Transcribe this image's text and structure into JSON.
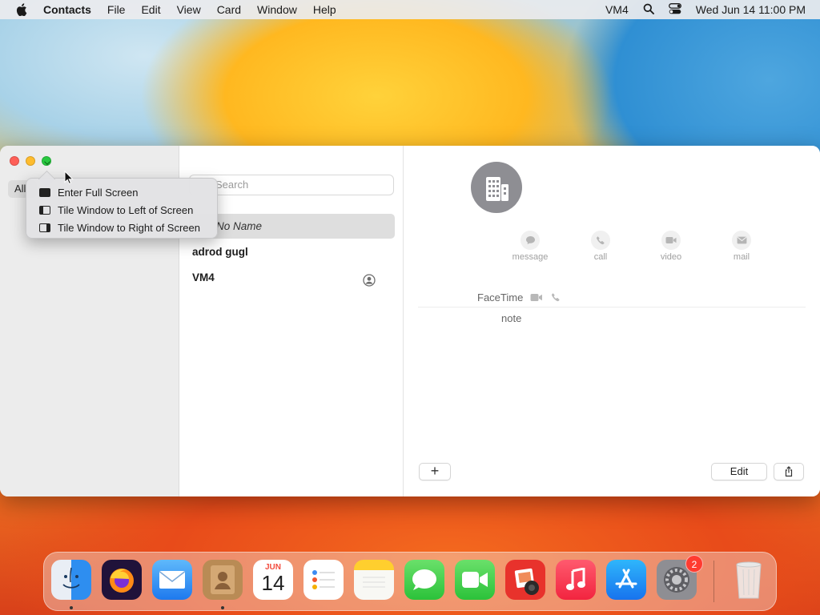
{
  "menubar": {
    "app_name": "Contacts",
    "items": [
      "File",
      "Edit",
      "View",
      "Card",
      "Window",
      "Help"
    ],
    "user": "VM4",
    "datetime": "Wed Jun 14  11:00 PM"
  },
  "sidebar": {
    "all_label": "All"
  },
  "popup": {
    "items": [
      "Enter Full Screen",
      "Tile Window to Left of Screen",
      "Tile Window to Right of Screen"
    ]
  },
  "list": {
    "search_placeholder": "Search",
    "selected_row": "No Name",
    "contacts": [
      "adrod gugl",
      "VM4"
    ]
  },
  "detail": {
    "actions": [
      "message",
      "call",
      "video",
      "mail"
    ],
    "facetime_label": "FaceTime",
    "note_label": "note",
    "add_label": "+",
    "edit_label": "Edit"
  },
  "dock": {
    "calendar_month": "JUN",
    "calendar_day": "14",
    "settings_badge": "2"
  }
}
